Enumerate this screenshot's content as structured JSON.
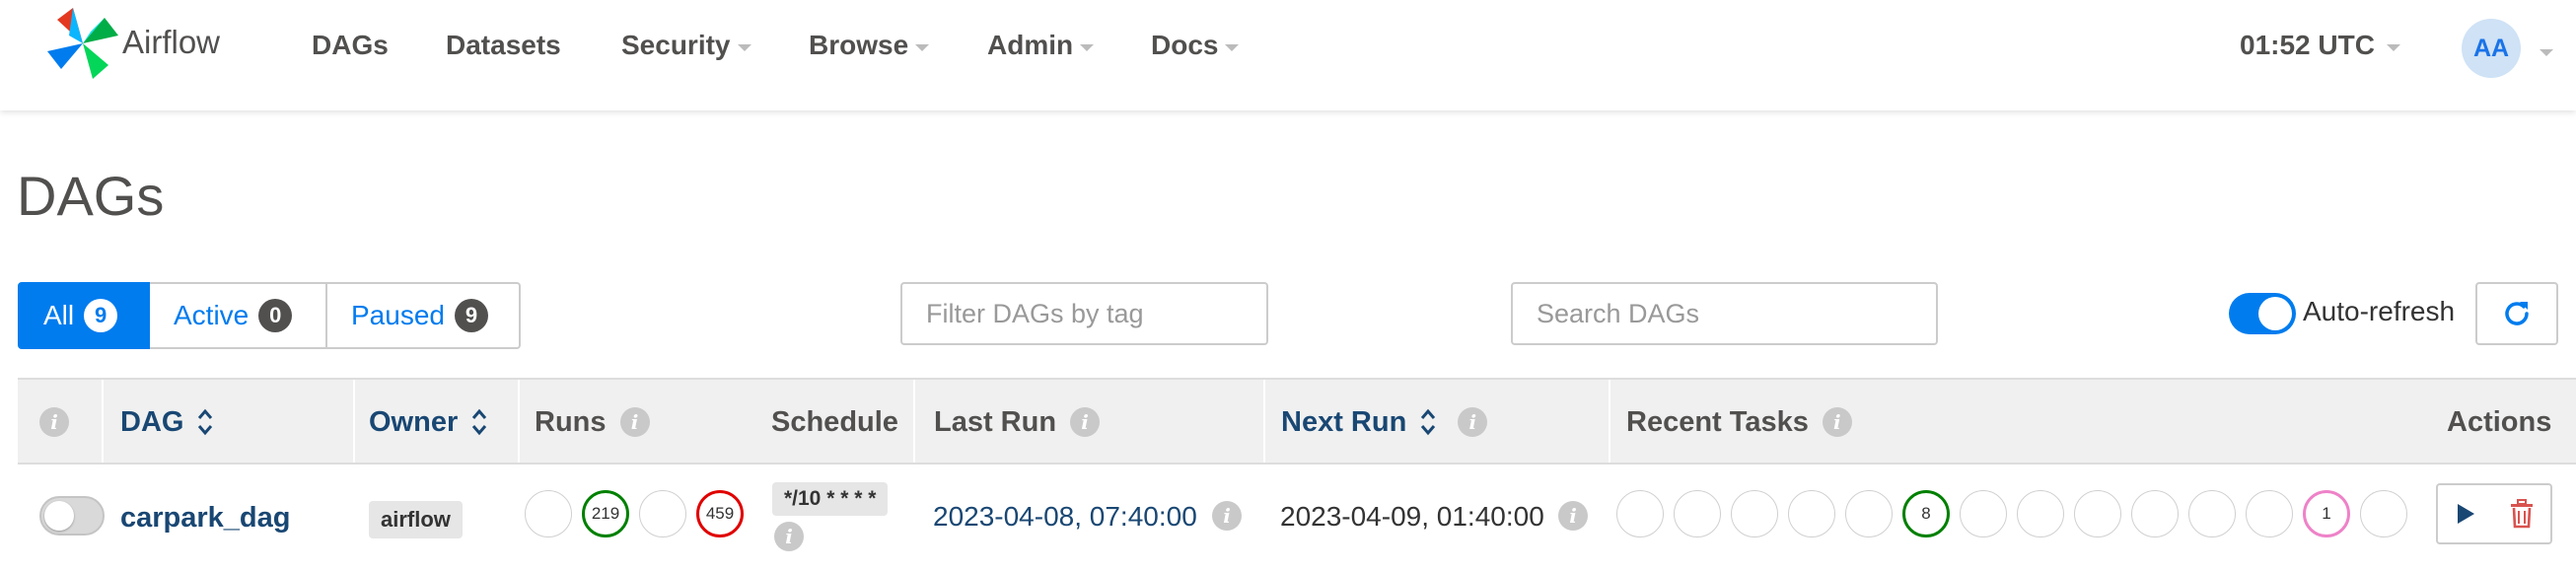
{
  "navbar": {
    "brand": "Airflow",
    "items": [
      "DAGs",
      "Datasets",
      "Security",
      "Browse",
      "Admin",
      "Docs"
    ],
    "time": "01:52 UTC",
    "user_initials": "AA"
  },
  "page_title": "DAGs",
  "status_filter": {
    "all_label": "All",
    "all_count": "9",
    "active_label": "Active",
    "active_count": "0",
    "paused_label": "Paused",
    "paused_count": "9"
  },
  "tag_filter": {
    "placeholder": "Filter DAGs by tag"
  },
  "search": {
    "placeholder": "Search DAGs"
  },
  "auto_refresh": {
    "label": "Auto-refresh",
    "enabled": true
  },
  "table": {
    "headers": {
      "dag": "DAG",
      "owner": "Owner",
      "runs": "Runs",
      "schedule": "Schedule",
      "last_run": "Last Run",
      "next_run": "Next Run",
      "recent_tasks": "Recent Tasks",
      "actions": "Actions"
    },
    "rows": [
      {
        "paused": true,
        "dag_id": "carpark_dag",
        "owner": "airflow",
        "runs": [
          "",
          "219",
          "",
          "459"
        ],
        "run_states": [
          "queued",
          "success",
          "running",
          "failed"
        ],
        "schedule": "*/10 * * * *",
        "last_run": "2023-04-08, 07:40:00",
        "next_run": "2023-04-09, 01:40:00",
        "recent_tasks": [
          "",
          "",
          "",
          "",
          "",
          "8",
          "",
          "",
          "",
          "",
          "",
          "",
          "1",
          ""
        ],
        "recent_task_states": [
          "none",
          "none",
          "none",
          "none",
          "none",
          "success",
          "none",
          "none",
          "none",
          "none",
          "none",
          "none",
          "up_for_retry",
          "none"
        ]
      }
    ]
  },
  "colors": {
    "primary": "#017cee",
    "link": "#194773",
    "success": "#008000",
    "failed": "#e00000",
    "retry": "#ee82c8",
    "delete": "#d9534f"
  }
}
